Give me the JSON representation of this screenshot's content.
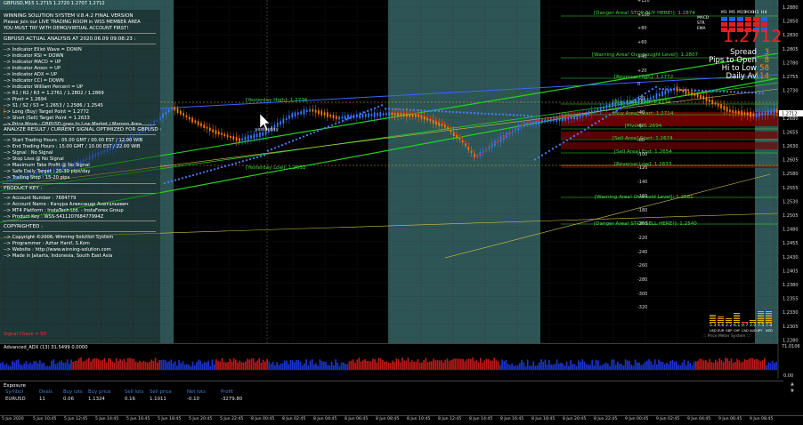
{
  "chart": {
    "symbol_header": "GBPUSD,M15  1.2715 1.2720 1.2707 1.2712",
    "price_scale": [
      "1.2880",
      "1.2850",
      "1.2830",
      "1.2805",
      "1.2780",
      "1.2755",
      "1.2730",
      "1.2712",
      "1.2680",
      "1.2655",
      "1.2630",
      "1.2605",
      "1.2580",
      "1.2555",
      "1.2530",
      "1.2505",
      "1.2480",
      "1.2455",
      "1.2430",
      "1.2405",
      "1.2380",
      "1.2355",
      "1.2330",
      "1.2305",
      "1.2280"
    ],
    "current_price_tag": "1.2712",
    "pip_scale": [
      "+120",
      "+100",
      "+80",
      "+60",
      "+40",
      "+20",
      "0",
      "-20",
      "-40",
      "-60",
      "-80",
      "-100",
      "-120",
      "-140",
      "-160",
      "-180",
      "-200",
      "-220",
      "-240",
      "-260",
      "-280",
      "-300",
      "-320"
    ],
    "time_labels": [
      "5 Jun 2020",
      "5 Jun 10:45",
      "5 Jun 12:45",
      "5 Jun 14:45",
      "5 Jun 16:45",
      "5 Jun 18:45",
      "5 Jun 20:45",
      "5 Jun 22:45",
      "8 Jun 00:45",
      "8 Jun 02:45",
      "8 Jun 04:45",
      "8 Jun 06:45",
      "8 Jun 08:45",
      "8 Jun 10:45",
      "8 Jun 12:45",
      "8 Jun 14:45",
      "8 Jun 16:45",
      "8 Jun 18:45",
      "8 Jun 20:45",
      "8 Jun 22:45",
      "9 Jun 00:45",
      "9 Jun 02:45",
      "9 Jun 04:45",
      "9 Jun 06:45",
      "9 Jun 08:45"
    ],
    "colors": {
      "bull": "#3a7bff",
      "bear": "#ff7a00",
      "session": "#2e5555",
      "grid": "#2a2a2a",
      "level_green": "#3cdc3c",
      "red_zone": "#8b0000"
    }
  },
  "info_panel": {
    "title": "WINNING SOLUTION SYSTEM V.8.4.2 FINAL VERSION",
    "line2": "Please join our LIVE TRADING ROOM in WSS MEMBER AREA",
    "line3": "YOU MUST TRY WITH DEMO/VIRTUAL ACCOUNT FIRST!",
    "analysis_title": "GBPUSD ACTUAL ANALYSIS AT 2020.06.09 09:08:23 :",
    "indicators": [
      "--> Indicator Elliot Wave = DOWN",
      "--> Indicator RSI = DOWN",
      "--> Indicator MACD = UP",
      "--> Indicator Aroon = UP",
      "--> Indicator ADX = UP",
      "--> Indicator CCI = DOWN",
      "--> Indicator William Percent = UP",
      "--> R1 / R2 / R3 = 1.2761 / 1.2802 / 1.2869",
      "--> Pivot = 1.2694",
      "--> S1 / S2 / S3 = 1.2653 / 1.2586 / 1.2545",
      "--> Long (Buy) Target Point = 1.2772",
      "--> Short (Sell) Target Point = 1.2633",
      "--> Price Move : GBPUSD goes to Low Market / Maroon Area"
    ],
    "result_title": "ANALYZE RESULT / CURRENT SIGNAL OPTIMIZED FOR GBPUSD :",
    "results": [
      "--> Start Trading Hours : 05.00 GMT / 00.00 EST / 12.00 WIB",
      "--> End Trading Hours : 15.00 GMT / 10.00 EST / 22.00 WIB",
      "--> Signal : No Signal",
      "--> Stop Loss @ No Signal",
      "--> Maximum Take Profit @ No Signal",
      "--> Safe Daily Target : 20-30 pips/day",
      "--> Trailing Stop : 15-20 pips"
    ],
    "product_title": "PRODUCT KEY :",
    "product": [
      "--> Account Number : 7684779",
      "--> Account Name : Качура Александр Анатольевич",
      "--> MT4 Platform : InstaTech Ltd. - InstaForex Group",
      "--> Product Key : WSS-541120768477994Z"
    ],
    "copyright_title": "COPYRIGHTED :",
    "copyright": [
      "--> Copyright ©2006, Winning Solution System",
      "--> Programmer : Azhar Hanif, S.Kom",
      "--> Website : http://www.winning-solution.com",
      "--> Made in Jakarta, Indonesia, South East Asia"
    ],
    "signal_text": "Signal Check = 50"
  },
  "levels": {
    "danger_buy": "[Danger Area! STOP BUY HERE!]: 1.2874",
    "warning_buy": "[Warning Area! Overbought Level]: 1.2807",
    "rev_high": "[Reversal High]: 1.2772",
    "yesterday_high": "[Yesterday High]: 1.2736",
    "buy_end": "[Buy Area] End: 1.2734",
    "buy_start": "[Buy Area] Start: 1.2714",
    "pivot": "[Pivot]: 1.2694",
    "sell_start": "[Sell Area] Start: 1.2674",
    "sell_end": "[Sell Area] End: 1.2654",
    "rev_low": "[Reversal Low]: 1.2633",
    "yesterday_low": "[Yesterday Low]: 1.2632",
    "warning_sell": "[Warning Area! Oversold Level]: 1.2581",
    "danger_sell": "[Danger Area! STOP SELL HERE!]: 1.2540",
    "yesterday_mark": "yesterday"
  },
  "spread_box": {
    "big_price": "1.2712",
    "rows": [
      {
        "label": "Spread",
        "value": "3"
      },
      {
        "label": "Pips to Open",
        "value": "8"
      },
      {
        "label": "Hi to Low",
        "value": "58"
      },
      {
        "label": "Daily Av",
        "value": "114"
      }
    ]
  },
  "tf_grid": {
    "headers": [
      "M1",
      "M5",
      "M15",
      "M30",
      "H1",
      "H4"
    ],
    "rows": [
      "MACD",
      "STR",
      "EMA"
    ]
  },
  "strength": {
    "values": [
      "5.3",
      "4.6",
      "2.2",
      "6.1",
      "0.7",
      "2.0",
      "7.5",
      "7.0"
    ],
    "currencies": [
      "USD",
      "EUR",
      "GBP",
      "CHF",
      "CAD",
      "AUD",
      "JPY",
      "NZD"
    ],
    "caption": "::: Price Meter System :::"
  },
  "adx": {
    "label": "Advanced_ADX (13) 31.5499 0.0000",
    "scale_top": "71.0106",
    "scale_bottom": "0.00"
  },
  "exposure": {
    "title": "Exposure",
    "headers": [
      "Symbol",
      "Deals",
      "Buy lots",
      "Buy price",
      "Sell lots",
      "Sell price",
      "Net lots",
      "Profit"
    ],
    "row": [
      "EURUSD",
      "11",
      "0.06",
      "1.1324",
      "0.16",
      "1.1011",
      "-0.10",
      "-3279.80"
    ]
  }
}
